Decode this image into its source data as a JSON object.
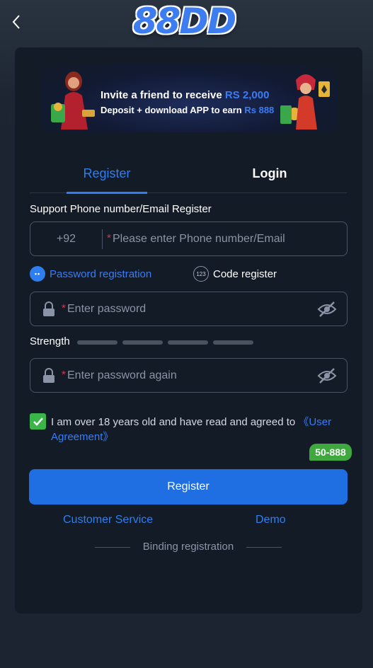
{
  "header": {
    "logo_text": "88DD"
  },
  "banner": {
    "line1_prefix": "Invite a friend to receive",
    "line1_amount": "RS 2,000",
    "line2_prefix": "Deposit + download APP to earn",
    "line2_amount": "Rs 888"
  },
  "tabs": {
    "register": "Register",
    "login": "Login"
  },
  "form": {
    "section_label": "Support Phone number/Email Register",
    "country_code": "+92",
    "phone_placeholder": "Please enter Phone number/Email",
    "required_mark": "*",
    "mode_password": "Password registration",
    "mode_code": "Code register",
    "password_placeholder": "Enter password",
    "password_again_placeholder": "Enter password again",
    "strength_label": "Strength",
    "agree_text": "I am over 18 years old and have read and agreed to ",
    "agree_link": "《User Agreement》",
    "badge": "50-888",
    "register_button": "Register"
  },
  "footer": {
    "customer_service": "Customer Service",
    "demo": "Demo",
    "binding": "Binding registration"
  },
  "colors": {
    "accent": "#2f7ef0",
    "background": "#1c2431",
    "card": "#131b27",
    "success": "#3bb54a",
    "required": "#d9364a"
  },
  "icons": {
    "back": "chevron-left-icon",
    "lock": "lock-icon",
    "eye": "eye-off-icon",
    "check": "check-icon"
  }
}
